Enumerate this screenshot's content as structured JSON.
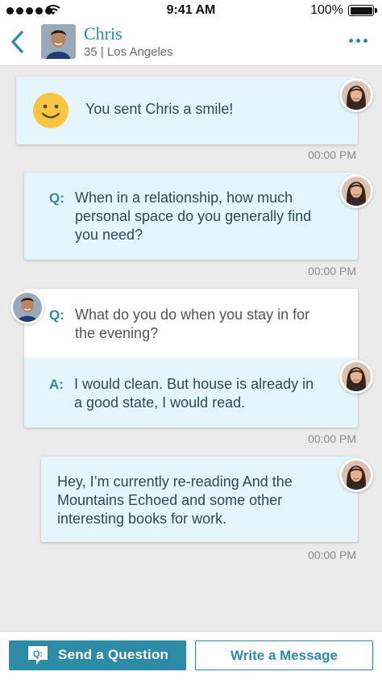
{
  "status_bar": {
    "time": "9:41 AM",
    "battery": "100%",
    "icons": [
      "signal-dots-icon",
      "wifi-icon",
      "battery-icon"
    ]
  },
  "header": {
    "name": "Chris",
    "subtitle": "35 | Los Angeles",
    "icons": [
      "back-chevron-icon",
      "more-dots-icon"
    ]
  },
  "messages": [
    {
      "text": "You sent Chris a smile!",
      "time": "00:00 PM"
    },
    {
      "prefix": "Q:",
      "text_lines": [
        "When in a relationship, how much",
        "personal space do you generally find",
        "you need?"
      ],
      "time": "00:00 PM"
    },
    {
      "question_prefix": "Q:",
      "question_lines": [
        "What do you do when you stay in for",
        "the evening?"
      ],
      "answer_prefix": "A:",
      "answer_lines": [
        "I would clean. But house is already in",
        "a good state, I would read."
      ],
      "time": "00:00 PM"
    },
    {
      "text_lines": [
        "Hey, I’m currently re-reading And the",
        "Mountains Echoed and some other",
        "interesting books for work."
      ],
      "time": "00:00 PM"
    }
  ],
  "footer": {
    "question_button": "Send a Question",
    "question_icon_text": "Q:",
    "message_button": "Write a Message"
  },
  "colors": {
    "accent": "#2d8ba5",
    "bubble": "#e4f5fb",
    "background": "#ebebeb"
  }
}
